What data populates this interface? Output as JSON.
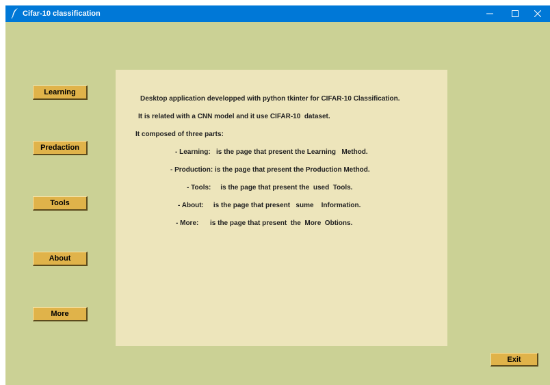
{
  "window": {
    "title": "Cifar-10 classification",
    "icon": "feather-icon",
    "controls": [
      "minimize-icon",
      "maximize-icon",
      "close-icon"
    ]
  },
  "sidebar": {
    "buttons": [
      {
        "label": "Learning"
      },
      {
        "label": "Predaction"
      },
      {
        "label": "Tools"
      },
      {
        "label": "About"
      },
      {
        "label": "More"
      }
    ]
  },
  "content": {
    "intro": "Desktop application developped with python tkinter for CIFAR-10 Classification.",
    "related": "It is related with a CNN model and it use CIFAR-10  dataset.",
    "composed": "It composed of three parts:",
    "parts": [
      "- Learning:   is the page that present the Learning   Method.",
      "- Production: is the page that present the Production Method.",
      "- Tools:     is the page that present the  used  Tools.",
      "- About:     is the page that present   sume    Information.",
      "- More:      is the page that present  the  More  Obtions."
    ]
  },
  "footer": {
    "exit_label": "Exit"
  },
  "colors": {
    "background": "#cbd195",
    "panel": "#ede5bb",
    "button": "#e0b34a",
    "titlebar": "#0078d7"
  }
}
